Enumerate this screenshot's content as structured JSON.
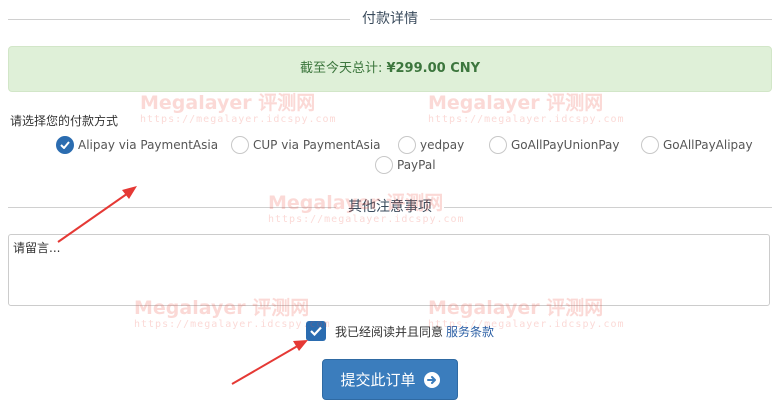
{
  "payment_section": {
    "title": "付款详情"
  },
  "total": {
    "label": "截至今天总计:",
    "amount": "¥299.00 CNY"
  },
  "payment_method": {
    "label": "请选择您的付款方式",
    "options": [
      {
        "label": "Alipay via PaymentAsia",
        "checked": true
      },
      {
        "label": "CUP via PaymentAsia",
        "checked": false
      },
      {
        "label": "yedpay",
        "checked": false
      },
      {
        "label": "GoAllPayUnionPay",
        "checked": false
      },
      {
        "label": "GoAllPayAlipay",
        "checked": false
      },
      {
        "label": "PayPal",
        "checked": false
      }
    ]
  },
  "notes_section": {
    "title": "其他注意事项",
    "placeholder": "请留言..."
  },
  "tos": {
    "text": "我已经阅读并且同意",
    "link": "服务条款",
    "checked": true
  },
  "submit": {
    "label": "提交此订单",
    "icon": "arrow-circle-right-icon"
  },
  "watermark": {
    "text": "Megalayer 评测网",
    "url": "https://megalayer.idcspy.com"
  },
  "colors": {
    "accent": "#2b6cb0",
    "success_bg": "#dff0d8",
    "success_text": "#3c763d",
    "annotation": "#e53935"
  }
}
